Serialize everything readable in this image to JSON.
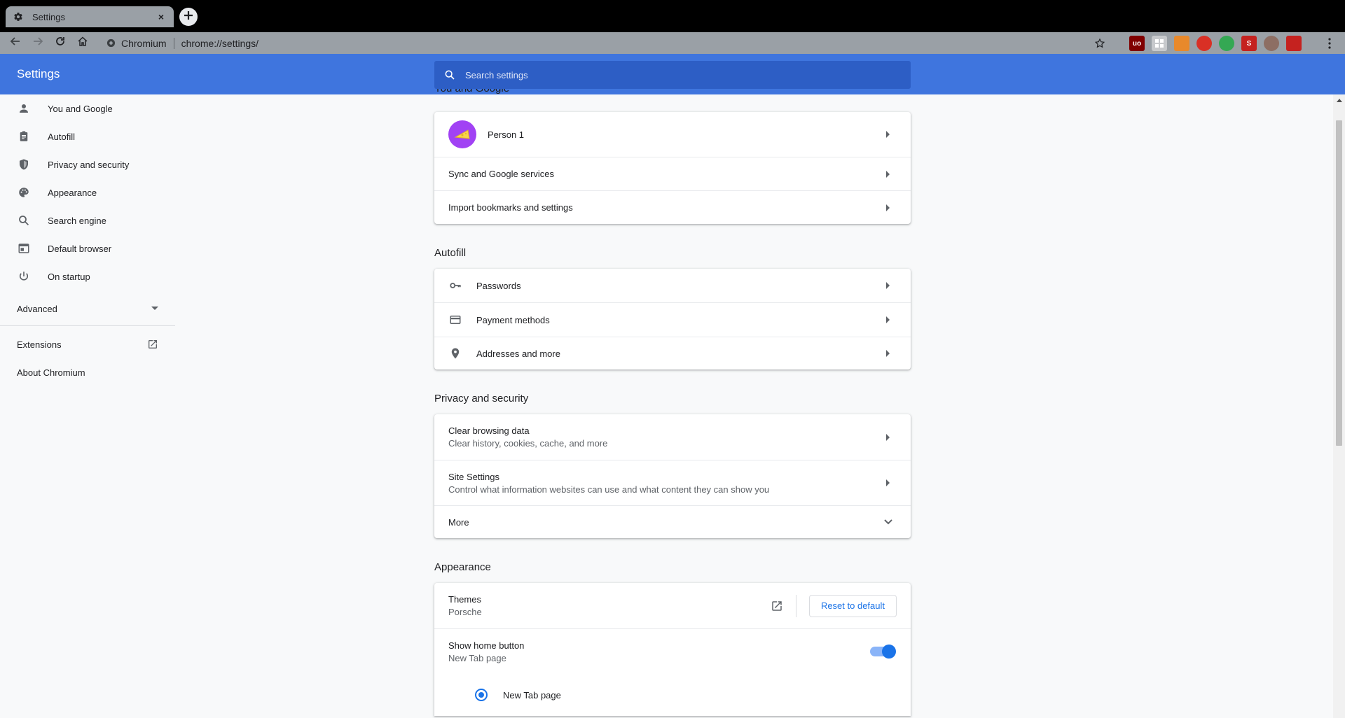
{
  "tab": {
    "title": "Settings",
    "icon": "gear-icon",
    "close": "×"
  },
  "omnibox": {
    "site_name": "Chromium",
    "url": "chrome://settings/"
  },
  "header": {
    "title": "Settings",
    "search_placeholder": "Search settings"
  },
  "sidebar": {
    "items": [
      {
        "label": "You and Google",
        "icon": "person-icon"
      },
      {
        "label": "Autofill",
        "icon": "clipboard-icon"
      },
      {
        "label": "Privacy and security",
        "icon": "shield-icon"
      },
      {
        "label": "Appearance",
        "icon": "palette-icon"
      },
      {
        "label": "Search engine",
        "icon": "search-icon"
      },
      {
        "label": "Default browser",
        "icon": "browser-window-icon"
      },
      {
        "label": "On startup",
        "icon": "power-icon"
      }
    ],
    "advanced": "Advanced",
    "extensions": "Extensions",
    "about": "About Chromium"
  },
  "you_and_google": {
    "title": "You and Google",
    "person": "Person 1",
    "sync": "Sync and Google services",
    "import": "Import bookmarks and settings"
  },
  "autofill": {
    "title": "Autofill",
    "passwords": "Passwords",
    "payment": "Payment methods",
    "addresses": "Addresses and more"
  },
  "privacy": {
    "title": "Privacy and security",
    "clear_title": "Clear browsing data",
    "clear_sub": "Clear history, cookies, cache, and more",
    "site_title": "Site Settings",
    "site_sub": "Control what information websites can use and what content they can show you",
    "more": "More"
  },
  "appearance": {
    "title": "Appearance",
    "themes_title": "Themes",
    "themes_sub": "Porsche",
    "reset": "Reset to default",
    "home_title": "Show home button",
    "home_sub": "New Tab page",
    "home_enabled": true,
    "radio_new_tab": "New Tab page"
  },
  "colors": {
    "accent": "#1a73e8",
    "header": "#3f75de",
    "search": "#2d5ec5"
  }
}
